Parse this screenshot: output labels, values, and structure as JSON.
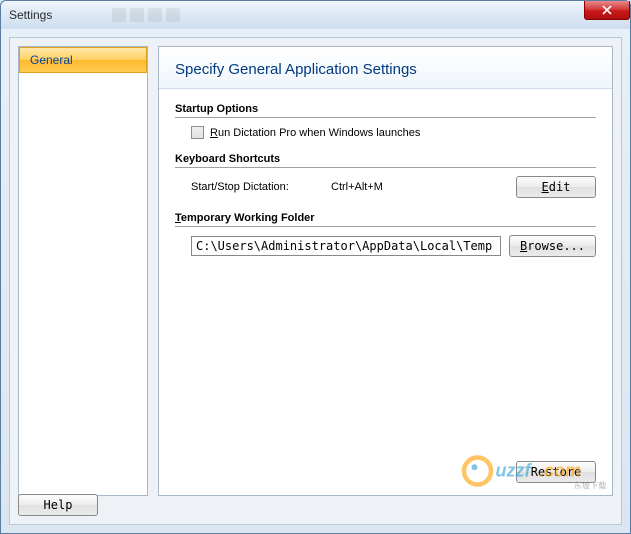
{
  "window": {
    "title": "Settings"
  },
  "sidebar": {
    "items": [
      {
        "label": "General"
      }
    ]
  },
  "panel": {
    "heading": "Specify General Application Settings"
  },
  "startup": {
    "title": "Startup Options",
    "checkbox_label": "Run Dictation Pro when Windows launches",
    "checked": false
  },
  "keyboard": {
    "title": "Keyboard Shortcuts",
    "row_label": "Start/Stop Dictation:",
    "row_value": "Ctrl+Alt+M",
    "edit_btn": "Edit"
  },
  "folder": {
    "title": "Temporary Working Folder",
    "path": "C:\\Users\\Administrator\\AppData\\Local\\Temp",
    "browse_btn": "Browse..."
  },
  "buttons": {
    "restore": "Restore",
    "help": "Help"
  },
  "watermark": {
    "text": "uzzf.com",
    "subtext": "东坡下载"
  }
}
